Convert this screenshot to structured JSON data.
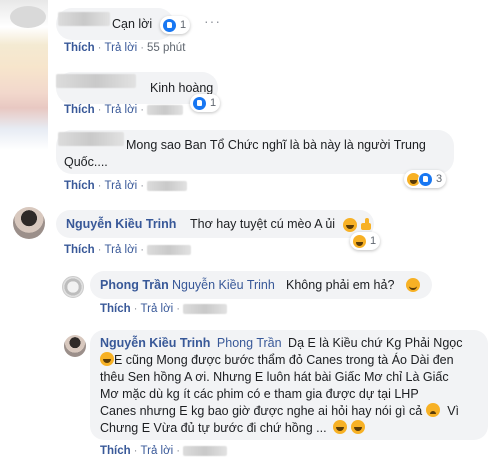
{
  "comments": [
    {
      "text": "Cạn lời",
      "reaction_count": "1",
      "like": "Thích",
      "reply": "Trả lời",
      "time": "55 phút"
    },
    {
      "text": "Kinh hoàng",
      "reaction_count": "1",
      "like": "Thích",
      "reply": "Trả lời"
    },
    {
      "text_line1": "Mong sao Ban Tổ Chức nghĩ là bà này là người Trung",
      "text_line2": "Quốc....",
      "reaction_count": "3",
      "like": "Thích",
      "reply": "Trả lời"
    },
    {
      "author": "Nguyễn Kiều Trinh",
      "text": "Thơ hay tuyệt cú mèo A ủi",
      "reaction_count": "1",
      "like": "Thích",
      "reply": "Trả lời"
    },
    {
      "author": "Phong Trần",
      "mention": "Nguyễn Kiều Trinh",
      "text": "Không phải em hả?",
      "like": "Thích",
      "reply": "Trả lời"
    },
    {
      "author": "Nguyễn Kiều Trinh",
      "mention": "Phong Trần",
      "line1": "Dạ E là Kiều chứ Kg Phải Ngọc",
      "line2": "E cũng Mong được bước thẩm đỏ Canes trong tà Áo Dài đen",
      "line3": "thêu Sen hồng A ơi. Nhưng E luôn hát bài Giấc Mơ chỉ Là Giấc",
      "line4": "Mơ mặc dù kg ít các phim có e tham gia được dự tại LHP",
      "line5": "Canes nhưng E kg bao giờ được nghe ai hỏi hay nói gì cả",
      "line6a": "Vì",
      "line6": "Chưng E Vừa đủ tự bước đi chứ hồng ...",
      "like": "Thích",
      "reply": "Trả lời"
    }
  ],
  "colors": {
    "link": "#385898",
    "bubble": "#f2f3f5",
    "meta": "#606770"
  },
  "icons": [
    "like-icon",
    "haha-icon",
    "more-options-icon"
  ]
}
